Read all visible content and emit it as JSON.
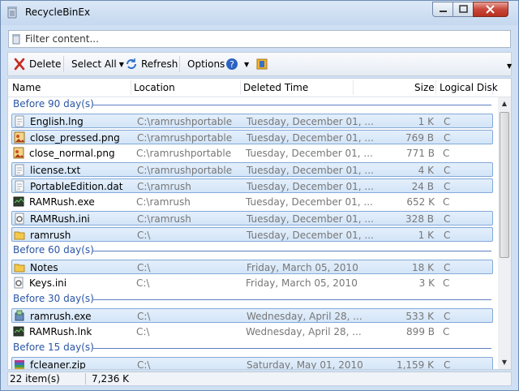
{
  "window": {
    "title": "RecycleBinEx"
  },
  "filter": {
    "placeholder": "Filter content..."
  },
  "toolbar": {
    "delete": "Delete",
    "select_all": "Select All",
    "refresh": "Refresh",
    "options": "Options"
  },
  "columns": [
    "Name",
    "Location",
    "Deleted Time",
    "Size",
    "Logical Disk"
  ],
  "groups": [
    {
      "label": "Before 90 day(s)",
      "rows": [
        {
          "name": "English.lng",
          "location": "C:\\ramrushportable",
          "deleted": "Tuesday, December 01, ...",
          "size": "1 K",
          "disk": "C",
          "selected": true,
          "icon": "text-file-icon"
        },
        {
          "name": "close_pressed.png",
          "location": "C:\\ramrushportable",
          "deleted": "Tuesday, December 01, ...",
          "size": "769 B",
          "disk": "C",
          "selected": true,
          "icon": "image-file-icon"
        },
        {
          "name": "close_normal.png",
          "location": "C:\\ramrushportable",
          "deleted": "Tuesday, December 01, ...",
          "size": "771 B",
          "disk": "C",
          "selected": false,
          "icon": "image-file-icon"
        },
        {
          "name": "license.txt",
          "location": "C:\\ramrushportable",
          "deleted": "Tuesday, December 01, ...",
          "size": "4 K",
          "disk": "C",
          "selected": true,
          "icon": "text-file-icon"
        },
        {
          "name": "PortableEdition.dat",
          "location": "C:\\ramrush",
          "deleted": "Tuesday, December 01, ...",
          "size": "24 B",
          "disk": "C",
          "selected": true,
          "icon": "text-file-icon"
        },
        {
          "name": "RAMRush.exe",
          "location": "C:\\ramrush",
          "deleted": "Tuesday, December 01, ...",
          "size": "652 K",
          "disk": "C",
          "selected": false,
          "icon": "exe-icon"
        },
        {
          "name": "RAMRush.ini",
          "location": "C:\\ramrush",
          "deleted": "Tuesday, December 01, ...",
          "size": "328 B",
          "disk": "C",
          "selected": true,
          "icon": "settings-file-icon"
        },
        {
          "name": "ramrush",
          "location": "C:\\",
          "deleted": "Tuesday, December 01, ...",
          "size": "1 K",
          "disk": "C",
          "selected": true,
          "icon": "folder-icon"
        }
      ]
    },
    {
      "label": "Before 60 day(s)",
      "rows": [
        {
          "name": "Notes",
          "location": "C:\\",
          "deleted": "Friday, March 05, 2010",
          "size": "18 K",
          "disk": "C",
          "selected": true,
          "icon": "folder-icon"
        },
        {
          "name": "Keys.ini",
          "location": "C:\\",
          "deleted": "Friday, March 05, 2010",
          "size": "3 K",
          "disk": "C",
          "selected": false,
          "icon": "settings-file-icon"
        }
      ]
    },
    {
      "label": "Before 30 day(s)",
      "rows": [
        {
          "name": "ramrush.exe",
          "location": "C:\\",
          "deleted": "Wednesday, April 28, ...",
          "size": "533 K",
          "disk": "C",
          "selected": true,
          "icon": "installer-icon"
        },
        {
          "name": "RAMRush.lnk",
          "location": "C:\\",
          "deleted": "Wednesday, April 28, ...",
          "size": "899 B",
          "disk": "C",
          "selected": false,
          "icon": "exe-icon"
        }
      ]
    },
    {
      "label": "Before 15 day(s)",
      "rows": [
        {
          "name": "fcleaner.zip",
          "location": "C:\\",
          "deleted": "Saturday, May 01, 2010",
          "size": "1,159 K",
          "disk": "C",
          "selected": true,
          "icon": "archive-icon"
        }
      ]
    }
  ],
  "status": {
    "items": "22 item(s)",
    "total_size": "7,236 K"
  },
  "colors": {
    "accent": "#2a55a5",
    "selection": "#d3e5f8",
    "selection_border": "#84a9d8"
  }
}
